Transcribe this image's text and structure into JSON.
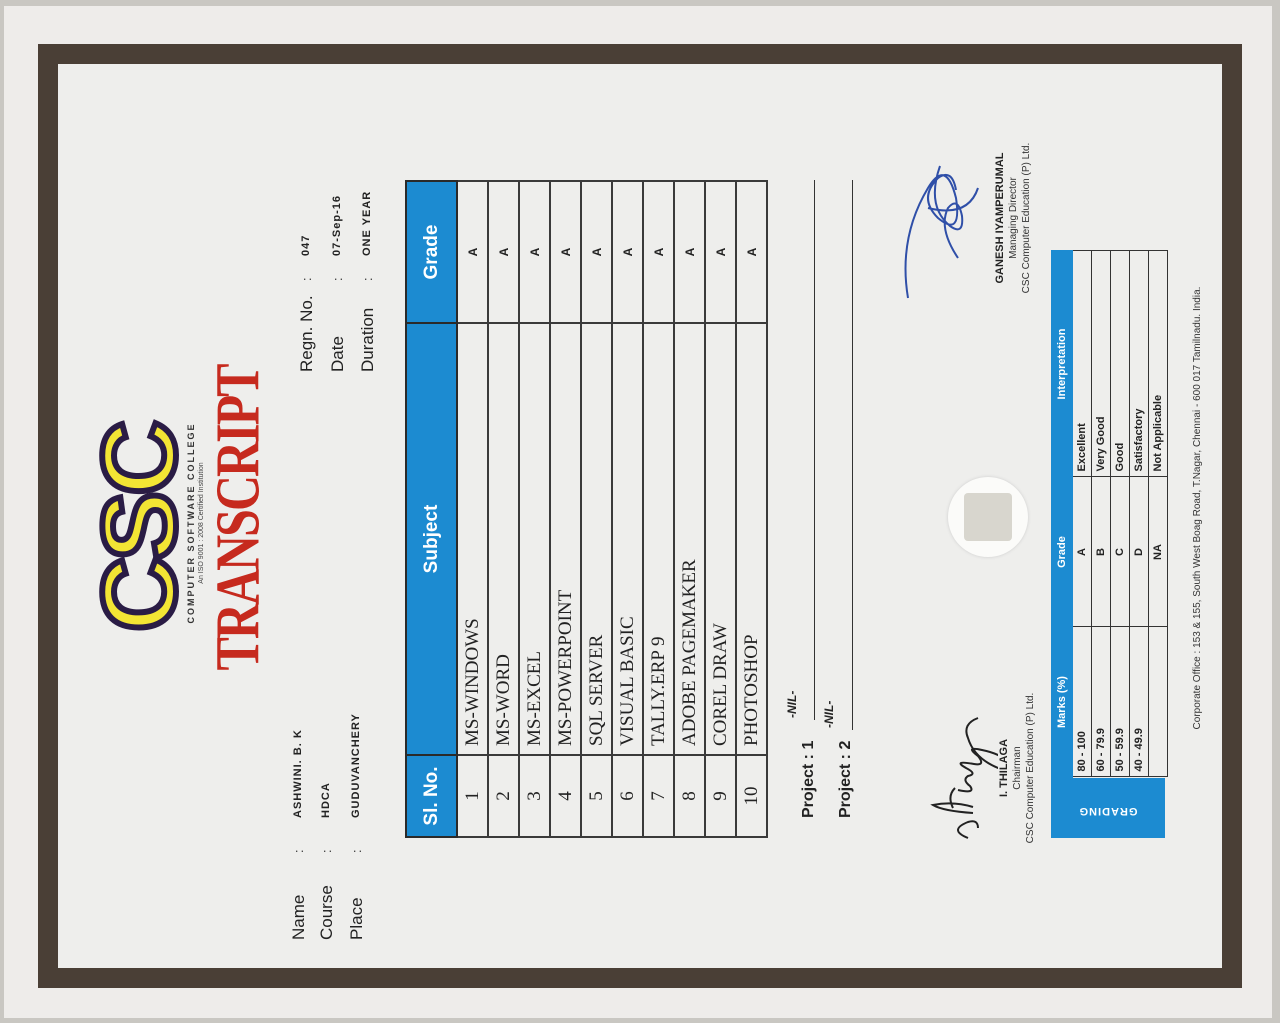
{
  "header": {
    "logo": "CSC",
    "logo_subtitle": "COMPUTER SOFTWARE COLLEGE",
    "logo_tagline": "An ISO 9001 : 2008 Certified Institution",
    "title": "TRANSCRIPT"
  },
  "student": {
    "name_label": "Name",
    "name_value": "ASHWINI. B. K",
    "course_label": "Course",
    "course_value": "HDCA",
    "place_label": "Place",
    "place_value": "GUDUVANCHERY",
    "regn_label": "Regn. No.",
    "regn_value": "047",
    "date_label": "Date",
    "date_value": "07-Sep-16",
    "duration_label": "Duration",
    "duration_value": "ONE YEAR",
    "colon": ":"
  },
  "subjects_table": {
    "headers": [
      "Sl. No.",
      "Subject",
      "Grade"
    ],
    "rows": [
      {
        "no": "1",
        "subject": "MS-WINDOWS",
        "grade": "A"
      },
      {
        "no": "2",
        "subject": "MS-WORD",
        "grade": "A"
      },
      {
        "no": "3",
        "subject": "MS-EXCEL",
        "grade": "A"
      },
      {
        "no": "4",
        "subject": "MS-POWERPOINT",
        "grade": "A"
      },
      {
        "no": "5",
        "subject": "SQL SERVER",
        "grade": "A"
      },
      {
        "no": "6",
        "subject": "VISUAL BASIC",
        "grade": "A"
      },
      {
        "no": "7",
        "subject": "TALLY.ERP 9",
        "grade": "A"
      },
      {
        "no": "8",
        "subject": "ADOBE PAGEMAKER",
        "grade": "A"
      },
      {
        "no": "9",
        "subject": "COREL DRAW",
        "grade": "A"
      },
      {
        "no": "10",
        "subject": "PHOTOSHOP",
        "grade": "A"
      }
    ]
  },
  "projects": {
    "project1_label": "Project : 1",
    "project1_value": "-NIL-",
    "project2_label": "Project : 2",
    "project2_value": "-NIL-"
  },
  "grading_table": {
    "label": "GRADING",
    "headers": [
      "Marks (%)",
      "Grade",
      "Interpretation"
    ],
    "rows": [
      {
        "marks": "80 - 100",
        "grade": "A",
        "interpretation": "Excellent"
      },
      {
        "marks": "60 - 79.9",
        "grade": "B",
        "interpretation": "Very Good"
      },
      {
        "marks": "50 - 59.9",
        "grade": "C",
        "interpretation": "Good"
      },
      {
        "marks": "40 - 49.9",
        "grade": "D",
        "interpretation": "Satisfactory"
      },
      {
        "marks": "",
        "grade": "NA",
        "interpretation": "Not Applicable"
      }
    ]
  },
  "signatures": {
    "left": {
      "script": "I. Thilaga",
      "name": "I. THILAGA",
      "role": "Chairman",
      "org": "CSC Computer Education (P) Ltd."
    },
    "right": {
      "name": "GANESH IYAMPERUMAL",
      "role": "Managing Director",
      "org": "CSC Computer Education (P) Ltd."
    }
  },
  "footer": {
    "text": "Corporate Office : 153 & 155, South West Boag Road, T.Nagar, Chennai - 600 017 Tamilnadu. India."
  },
  "colors": {
    "table_header": "#1c8bd1",
    "title_red": "#c62a1e",
    "logo_yellow": "#f3e534",
    "logo_purple": "#2a1c45",
    "frame_brown": "#4a3f36"
  }
}
